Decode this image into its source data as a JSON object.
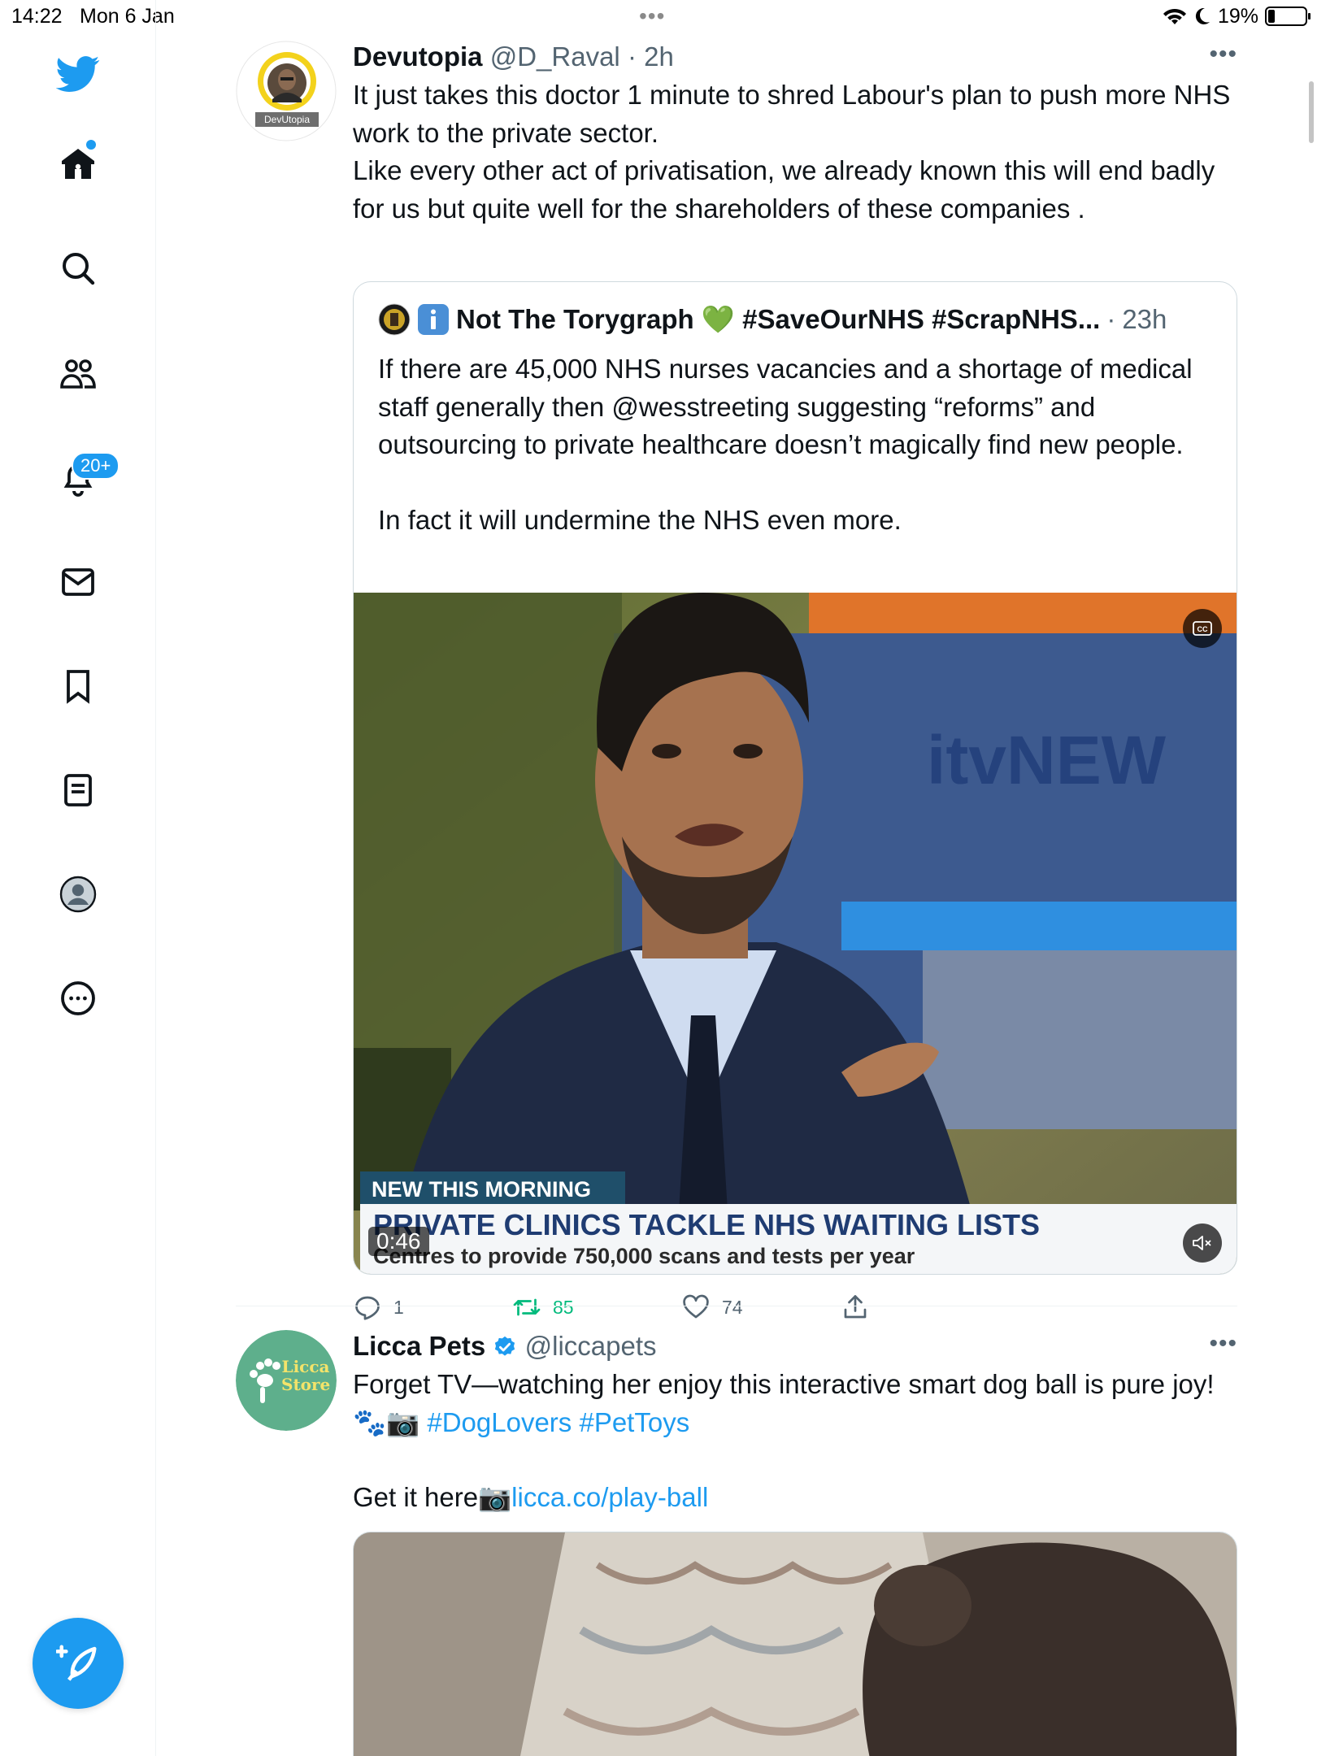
{
  "status_bar": {
    "time": "14:22",
    "date": "Mon 6 Jan",
    "battery": "19%",
    "battery_level": 0.19
  },
  "sidebar": {
    "items": [
      {
        "name": "home"
      },
      {
        "name": "search"
      },
      {
        "name": "communities"
      },
      {
        "name": "notifications",
        "badge": "20+"
      },
      {
        "name": "messages"
      },
      {
        "name": "bookmarks"
      },
      {
        "name": "lists"
      },
      {
        "name": "profile"
      },
      {
        "name": "more"
      }
    ]
  },
  "tweets": [
    {
      "name": "Devutopia",
      "handle": "@D_Raval",
      "sep": "·",
      "time": "2h",
      "avatar_label": "DevUtopia",
      "text": "It just takes this doctor 1 minute to shred Labour's plan to push more NHS work to the private sector.\nLike every other act of privatisation, we already known this will end badly for us but quite well for the shareholders of these companies .",
      "quote": {
        "name": "Not The Torygraph 💚 #SaveOurNHS #ScrapNHS...",
        "sep": "·",
        "time": "23h",
        "text": "If there are 45,000 NHS nurses vacancies and a shortage of medical staff generally then @wesstreeting suggesting “reforms” and outsourcing to private healthcare doesn’t magically find new people.\n\nIn fact it will undermine the NHS even more.",
        "video": {
          "channel": "itvNEW",
          "banner_tag": "NEW THIS MORNING",
          "headline": "PRIVATE CLINICS TACKLE NHS WAITING LISTS",
          "subline": "Centres to provide 750,000 scans and tests per year",
          "duration": "0:46"
        }
      },
      "actions": {
        "replies": "1",
        "retweets": "85",
        "likes": "74"
      }
    },
    {
      "name": "Licca Pets",
      "handle": "@liccapets",
      "avatar_label": "Licca Store",
      "text_1": "Forget TV—watching her enjoy this interactive smart dog ball is pure joy! 🐾📷 ",
      "hashtags": "#DogLovers #PetToys",
      "text_2": "Get it here📷",
      "link": "licca.co/play-ball"
    }
  ],
  "colors": {
    "accent": "#1d9bf0",
    "retweet_green": "#00ba7c",
    "text_secondary": "#536471"
  }
}
